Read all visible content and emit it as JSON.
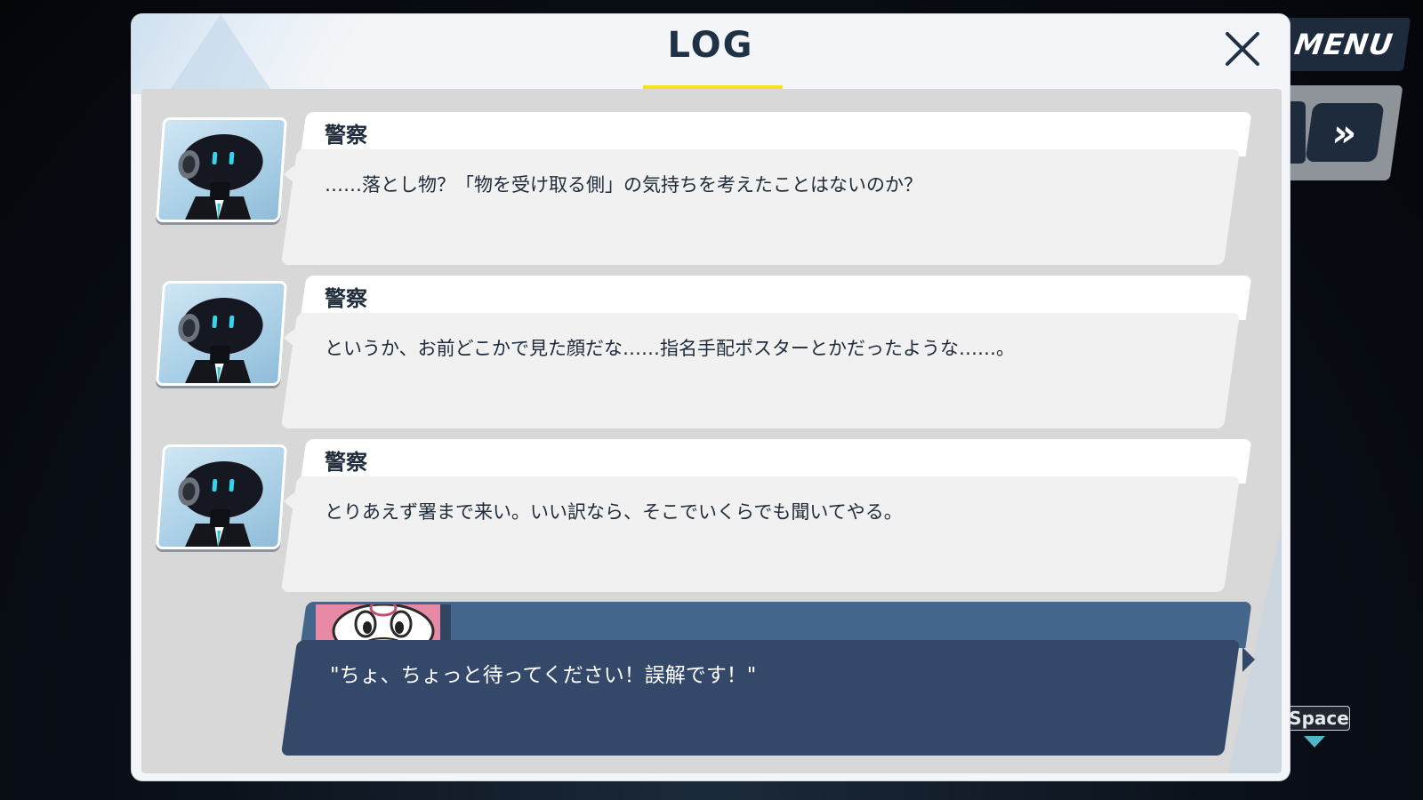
{
  "menu": {
    "label": "MENU"
  },
  "controls": {
    "skip_glyph": "»",
    "space_key": "Space"
  },
  "log": {
    "title": "LOG",
    "entries": [
      {
        "speaker": "警察",
        "text": "……落とし物？「物を受け取る側」の気持ちを考えたことはないのか？",
        "avatar": "police-robot-avatar"
      },
      {
        "speaker": "警察",
        "text": "というか、お前どこかで見た顔だな……指名手配ポスターとかだったような……。",
        "avatar": "police-robot-avatar"
      },
      {
        "speaker": "警察",
        "text": "とりあえず署まで来い。いい訳なら、そこでいくらでも聞いてやる。",
        "avatar": "police-robot-avatar"
      }
    ],
    "current": {
      "text": "\"ちょ、ちょっと待ってください！誤解です！\"",
      "avatar": "pink-character-avatar"
    }
  },
  "colors": {
    "title_underline": "#f4e21a",
    "current_bubble": "#34496a",
    "current_nameplate": "#44668d",
    "text_dark": "#1e2b3a"
  }
}
